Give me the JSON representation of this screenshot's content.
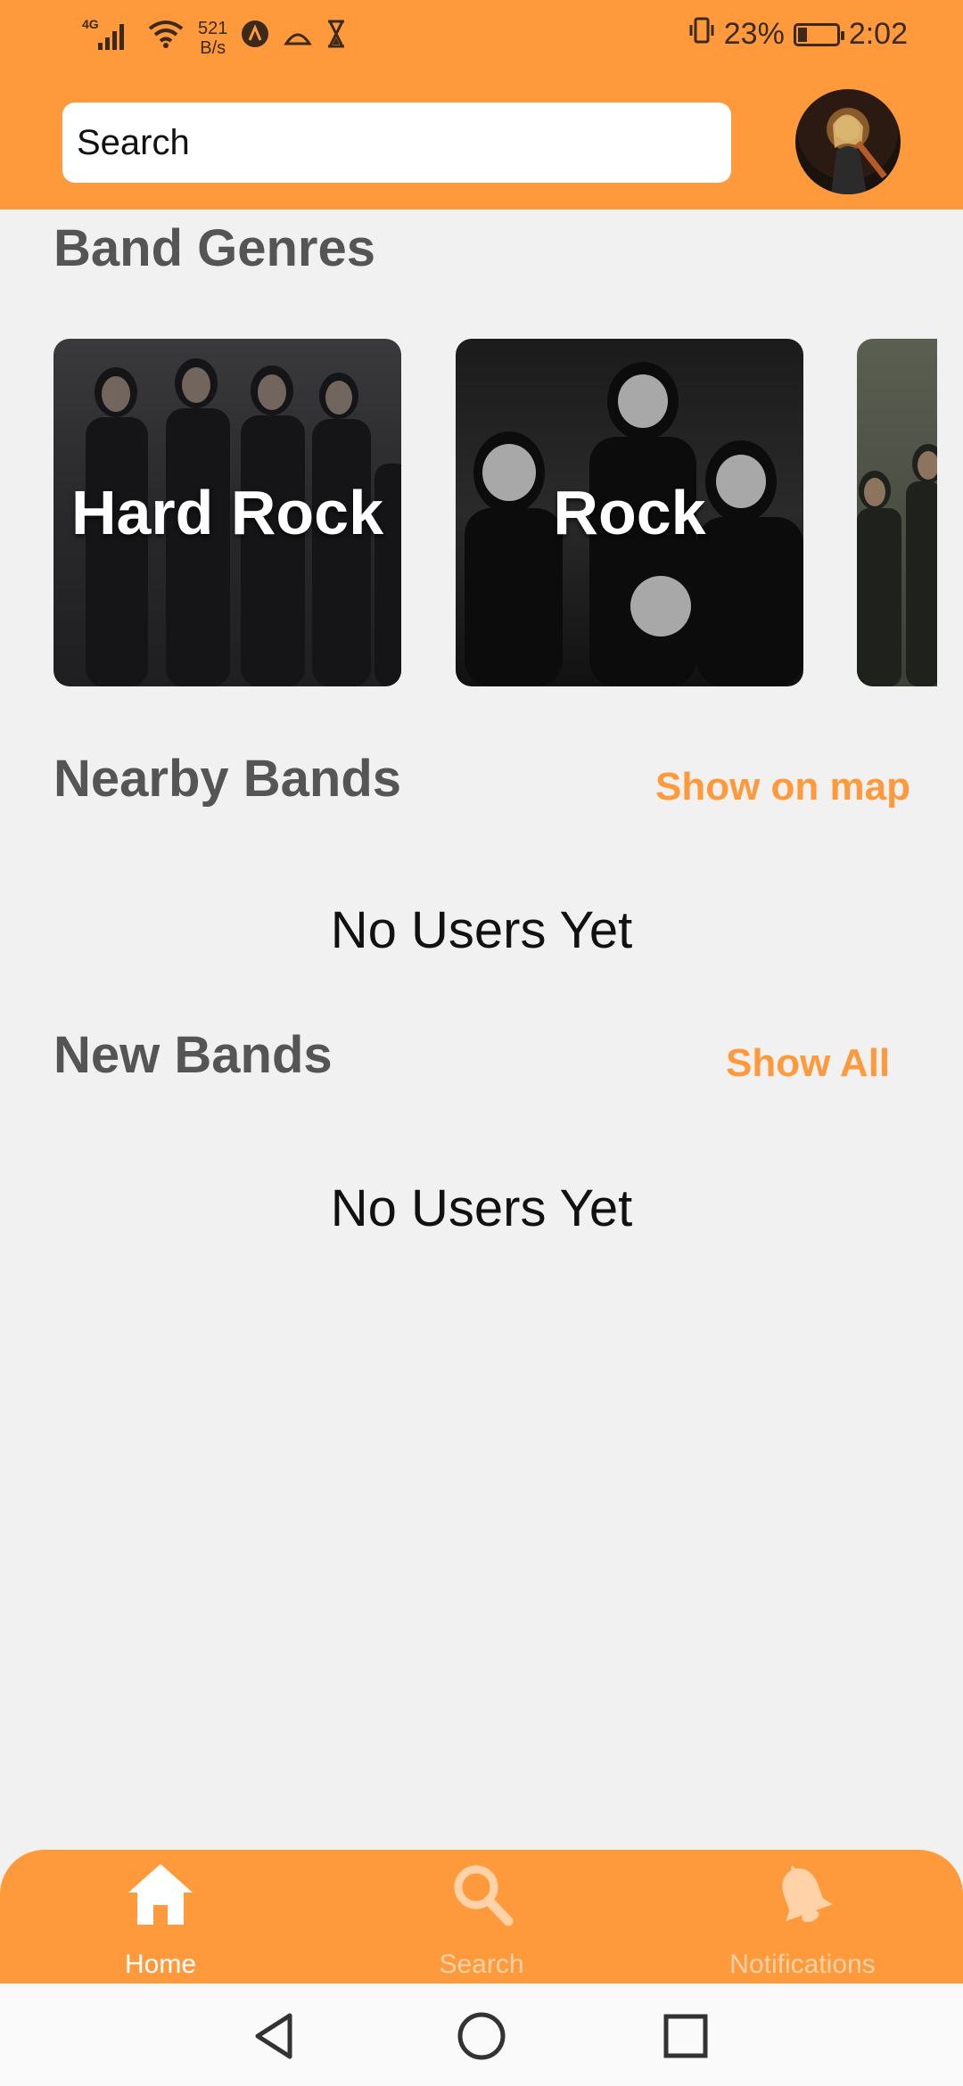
{
  "status_bar": {
    "network": "4G",
    "speed_value": "521",
    "speed_unit": "B/s",
    "battery_percent": "23%",
    "battery_level": 0.23,
    "time": "2:02"
  },
  "search": {
    "placeholder": "Search"
  },
  "colors": {
    "accent": "#ff9a3c",
    "background": "#f1f1f1",
    "section_title": "#555555"
  },
  "band_genres": {
    "title": "Band Genres",
    "items": [
      {
        "label": "Hard Rock"
      },
      {
        "label": "Rock"
      },
      {
        "label": ""
      }
    ]
  },
  "nearby_bands": {
    "title": "Nearby Bands",
    "action": "Show on map",
    "empty_message": "No Users Yet"
  },
  "new_bands": {
    "title": "New Bands",
    "action": "Show All",
    "empty_message": "No Users Yet"
  },
  "bottom_nav": {
    "items": [
      {
        "label": "Home",
        "icon": "home-icon",
        "active": true
      },
      {
        "label": "Search",
        "icon": "search-icon",
        "active": false
      },
      {
        "label": "Notifications",
        "icon": "bell-icon",
        "active": false
      }
    ]
  },
  "system_nav": {
    "buttons": [
      "back-icon",
      "home-circle-icon",
      "recents-icon"
    ]
  }
}
